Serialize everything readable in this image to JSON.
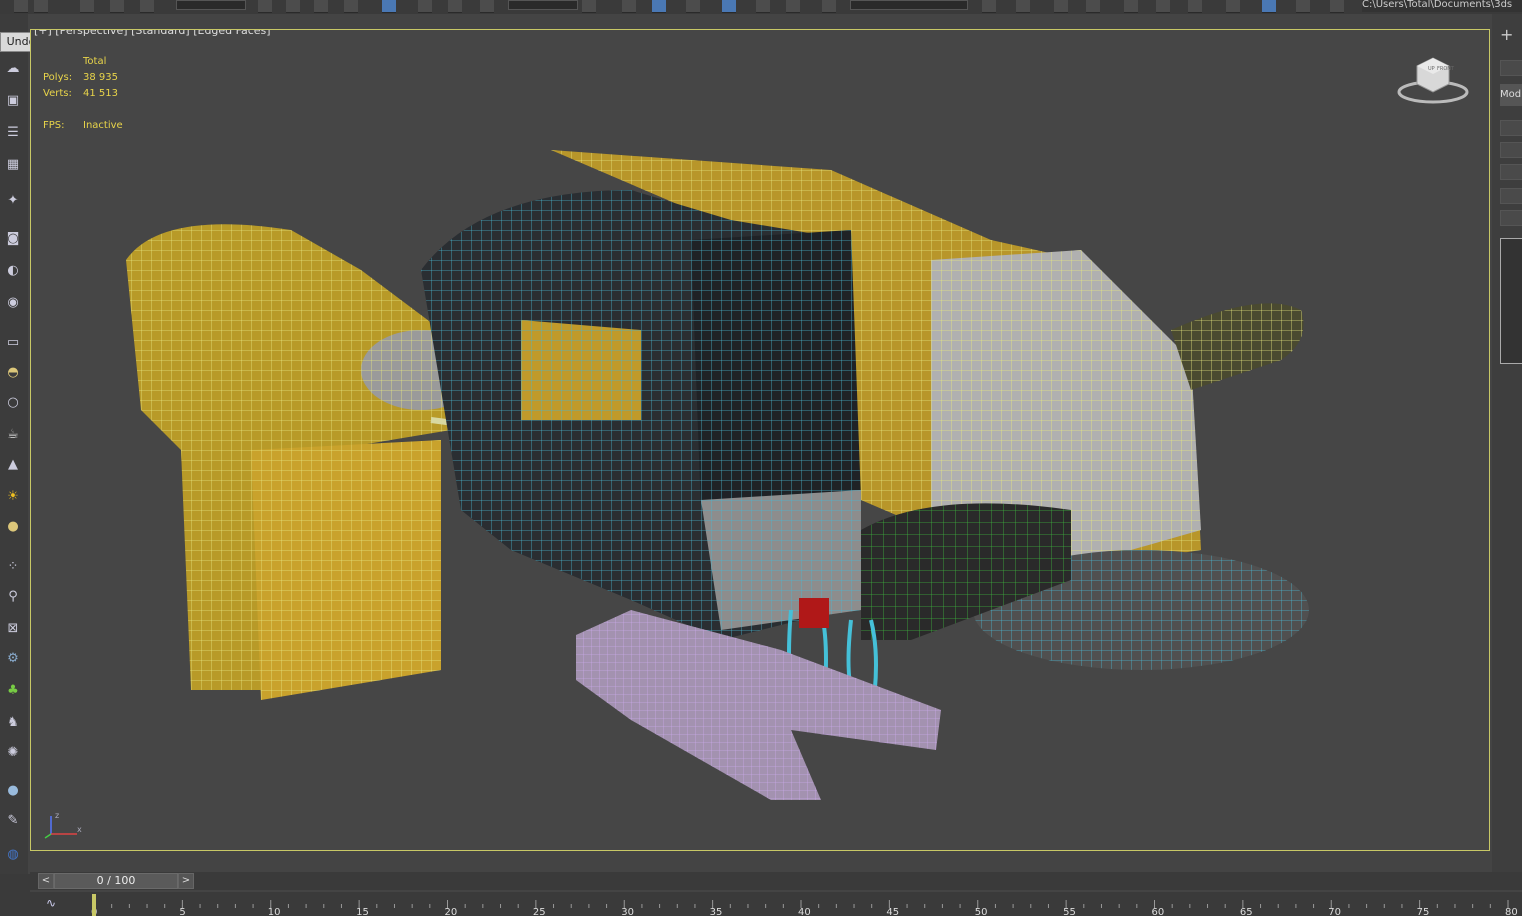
{
  "app": {
    "path_text": "C:\\Users\\Total\\Documents\\3ds"
  },
  "tooltip": {
    "label": "Undo"
  },
  "viewport": {
    "label": "[+] [Perspective] [Standard] [Edged Faces]",
    "stats": {
      "header": "Total",
      "polys_label": "Polys:",
      "polys_value": "38 935",
      "verts_label": "Verts:",
      "verts_value": "41 513",
      "fps_label": "FPS:",
      "fps_value": "Inactive"
    },
    "viewcube": {
      "top_text": "UP",
      "front_text": "FRONT"
    },
    "axis": {
      "z": "z",
      "x": "x"
    }
  },
  "right_panel": {
    "tab_label": "Mod"
  },
  "time_slider": {
    "value": "0 / 100",
    "prev": "<",
    "next": ">"
  },
  "track_bar": {
    "ticks": [
      "0",
      "5",
      "10",
      "15",
      "20",
      "25",
      "30",
      "35",
      "40",
      "45",
      "50",
      "55",
      "60",
      "65",
      "70",
      "75",
      "80"
    ]
  },
  "colors": {
    "stats": "#e8d44a",
    "viewport_border": "#c8c866",
    "viewport_bg": "#464646"
  },
  "icons": [
    "undo-icon",
    "redo-icon",
    "select-icon",
    "move-icon",
    "rotate-icon",
    "scale-icon",
    "cloud-icon",
    "render-icon",
    "camera-icon",
    "light-icon",
    "sphere-icon",
    "teapot-icon",
    "cone-icon",
    "sun-icon",
    "grass-icon",
    "gear-icon"
  ]
}
